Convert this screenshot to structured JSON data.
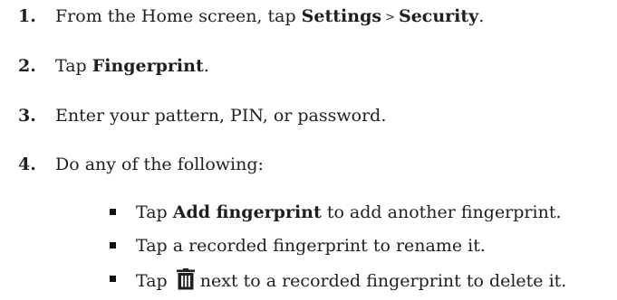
{
  "steps": [
    {
      "number": "1.",
      "text_before": "From the Home screen, tap ",
      "bold_1": "Settings",
      "separator": ">",
      "bold_2": "Security",
      "text_after": "."
    },
    {
      "number": "2.",
      "text_before": "Tap ",
      "bold": "Fingerprint",
      "text_after": "."
    },
    {
      "number": "3.",
      "text": "Enter your pattern, PIN, or password."
    },
    {
      "number": "4.",
      "text": "Do any of the following:"
    }
  ],
  "sub_items": [
    {
      "text_before": "Tap ",
      "bold": "Add fingerprint",
      "text_after": " to add another fingerprint."
    },
    {
      "text": "Tap a recorded fingerprint to rename it."
    },
    {
      "text_before": "Tap",
      "icon": "trash-icon",
      "text_after": "next to a recorded fingerprint to delete it."
    }
  ]
}
